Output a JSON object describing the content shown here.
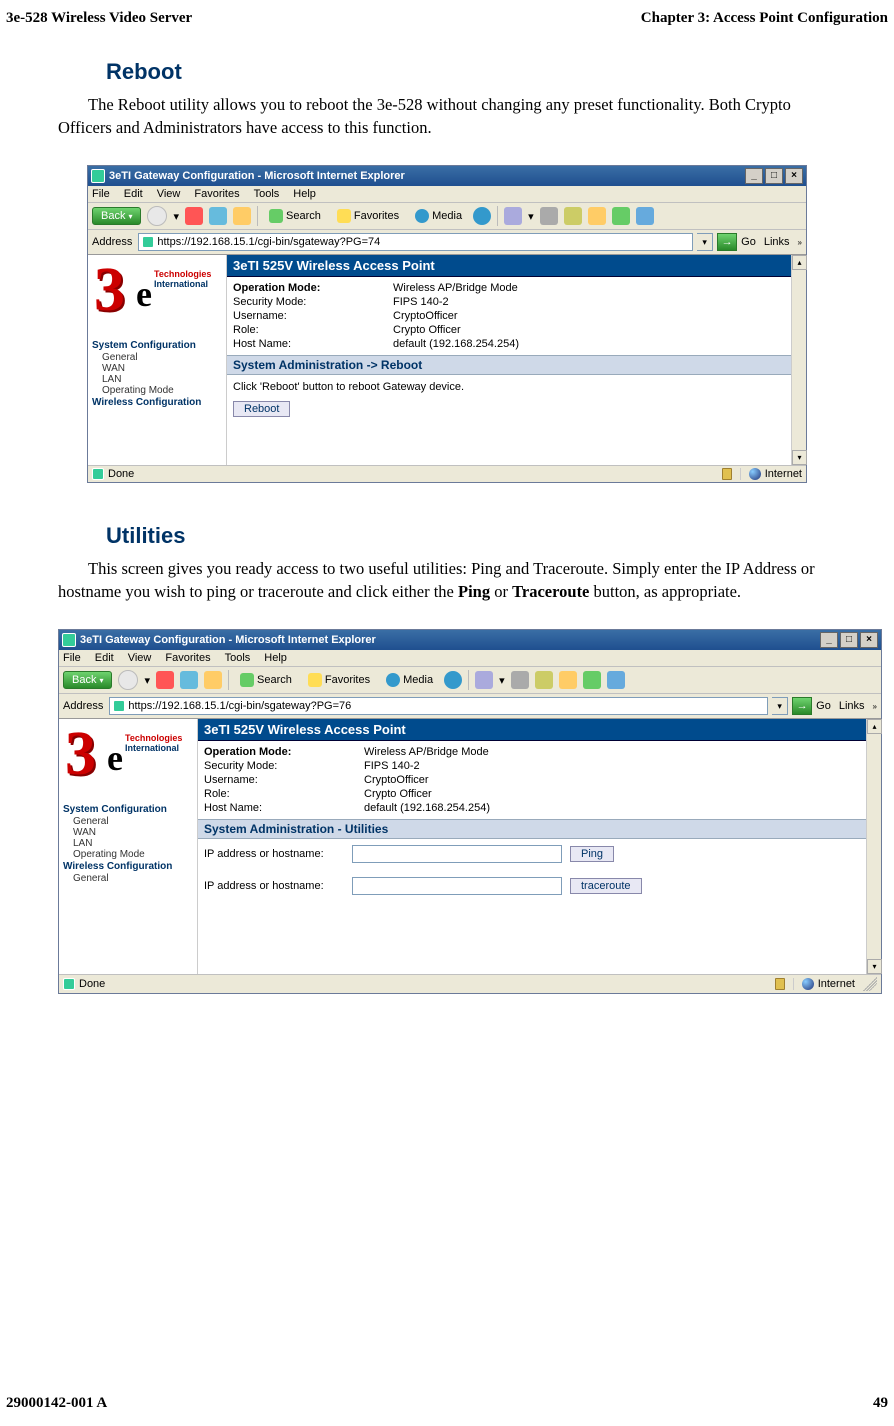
{
  "header": {
    "left": "3e-528 Wireless Video Server",
    "right": "Chapter 3: Access Point Configuration"
  },
  "footer": {
    "left": "29000142-001 A",
    "right": "49"
  },
  "section1": {
    "title": "Reboot",
    "para": "The Reboot utility allows you to reboot the 3e-528 without changing any preset functionality. Both Crypto Officers and Administrators have access to this function."
  },
  "section2": {
    "title": "Utilities",
    "para_pre": "This screen gives you ready access to two useful utilities: Ping and Traceroute. Simply enter the IP Address or hostname you wish to ping or traceroute and click either the ",
    "bold1": "Ping",
    "mid": " or ",
    "bold2": "Traceroute",
    "post": " button, as appropriate."
  },
  "ie": {
    "title": "3eTI Gateway Configuration - Microsoft Internet Explorer",
    "menus": [
      "File",
      "Edit",
      "View",
      "Favorites",
      "Tools",
      "Help"
    ],
    "back": "Back",
    "search": "Search",
    "favorites": "Favorites",
    "media": "Media",
    "addr_label": "Address",
    "go": "Go",
    "links": "Links",
    "status_done": "Done",
    "status_zone": "Internet"
  },
  "logo": {
    "t": "Technologies",
    "i": "International"
  },
  "sidebar": {
    "g1": "System Configuration",
    "items1": [
      "General",
      "WAN",
      "LAN",
      "Operating Mode"
    ],
    "g2": "Wireless Configuration",
    "items2": [
      "General"
    ]
  },
  "panel_header": "3eTI 525V Wireless Access Point",
  "info": {
    "op_l": "Operation Mode:",
    "op_v": "Wireless AP/Bridge Mode",
    "sec_l": "Security Mode:",
    "sec_v": "FIPS 140-2",
    "un_l": "Username:",
    "un_v": "CryptoOfficer",
    "role_l": "Role:",
    "role_v": "Crypto Officer",
    "host_l": "Host Name:",
    "host_v": "default (192.168.254.254)"
  },
  "screen1": {
    "url": "https://192.168.15.1/cgi-bin/sgateway?PG=74",
    "subheader": "System Administration -> Reboot",
    "instr": "Click 'Reboot' button to reboot Gateway device.",
    "btn": "Reboot"
  },
  "screen2": {
    "url": "https://192.168.15.1/cgi-bin/sgateway?PG=76",
    "subheader": "System Administration - Utilities",
    "row_label": "IP address or hostname:",
    "ping": "Ping",
    "trace": "traceroute"
  }
}
